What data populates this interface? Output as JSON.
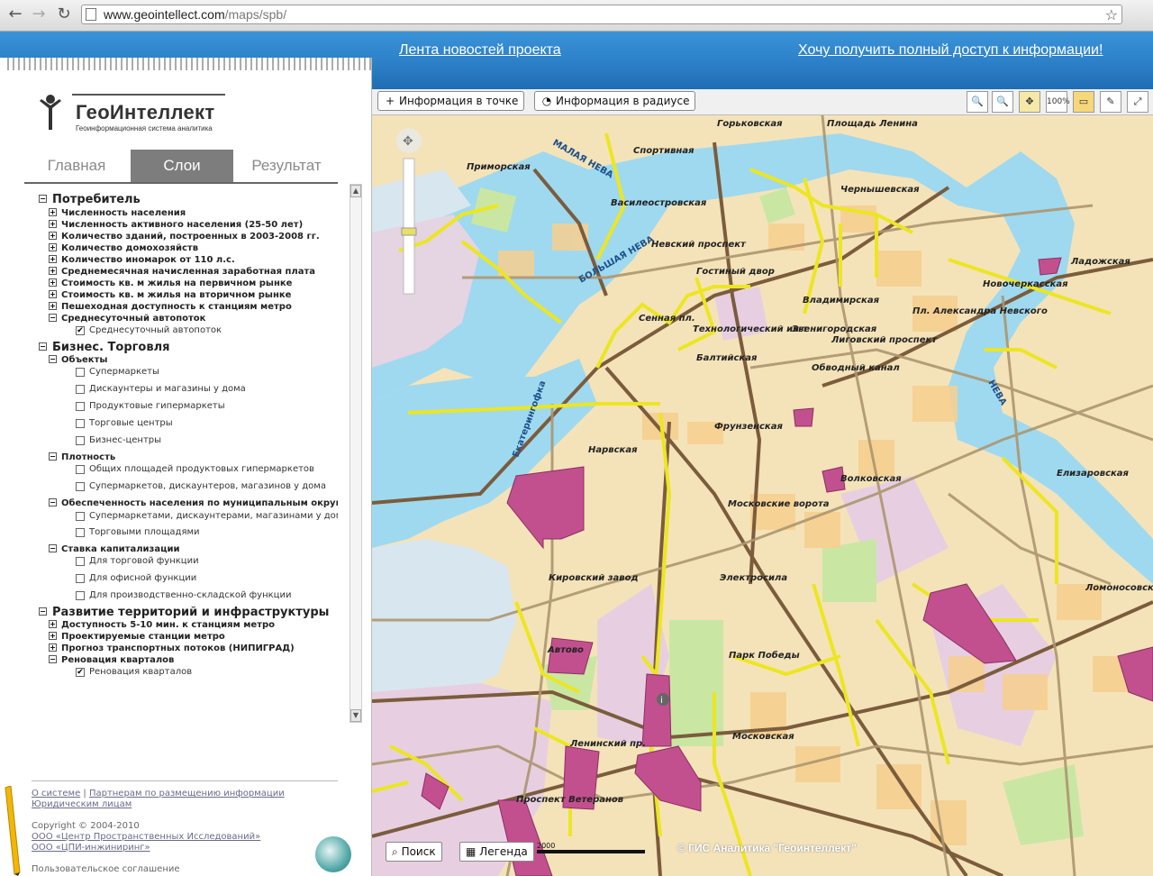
{
  "browser": {
    "url_host": "www.geointellect.com",
    "url_path": "/maps/spb/",
    "icons": [
      "back-icon",
      "forward-icon",
      "reload-icon",
      "page-icon",
      "star-icon"
    ]
  },
  "header": {
    "news_link": "Лента новостей проекта",
    "access_link": "Хочу получить полный доступ к информации!"
  },
  "logo": {
    "title": "ГеоИнтеллект",
    "subtitle": "Геоинформационная система аналитика"
  },
  "tabs": [
    {
      "label": "Главная",
      "active": false
    },
    {
      "label": "Слои",
      "active": true
    },
    {
      "label": "Результат",
      "active": false
    }
  ],
  "layers": {
    "group1": {
      "label": "Потребитель",
      "items": [
        "Численность населения",
        "Численность активного населения (25-50 лет)",
        "Количество зданий, построенных в 2003-2008 гг.",
        "Количество домохозяйств",
        "Количество иномарок от 110 л.с.",
        "Среднемесячная начисленная заработная плата",
        "Стоимость кв. м жилья на первичном рынке",
        "Стоимость кв. м жилья на вторичном рынке",
        "Пешеходная доступность к станциям метро",
        "Среднесуточный автопоток"
      ],
      "sub": {
        "label": "Среднесуточный автопоток",
        "checked": true
      }
    },
    "group2": {
      "label": "Бизнес. Торговля",
      "objects": {
        "label": "Объекты",
        "items": [
          "Супермаркеты",
          "Дискаунтеры и магазины у дома",
          "Продуктовые гипермаркеты",
          "Торговые центры",
          "Бизнес-центры"
        ]
      },
      "density": {
        "label": "Плотность",
        "items": [
          "Общих площадей продуктовых гипермаркетов",
          "Супермаркетов, дискаунтеров, магазинов у дома"
        ]
      },
      "provision": {
        "label": "Обеспеченность населения по муниципальным округам",
        "items": [
          "Супермаркетами, дискаунтерами, магазинами у дома",
          "Торговыми площадями"
        ]
      },
      "cap": {
        "label": "Ставка капитализации",
        "items": [
          "Для торговой функции",
          "Для офисной функции",
          "Для производственно-складской функции"
        ]
      }
    },
    "group3": {
      "label": "Развитие территорий и инфраструктуры",
      "items": [
        "Доступность 5-10 мин. к станциям метро",
        "Проектируемые станции метро",
        "Прогноз транспортных потоков (НИПИГРАД)",
        "Реновация кварталов"
      ],
      "sub": {
        "label": "Реновация кварталов",
        "checked": true
      }
    }
  },
  "footer": {
    "about": "О системе",
    "partners": "Партнерам по размещению информации",
    "legal": "Юридическим лицам",
    "copyright": "Copyright © 2004-2010",
    "org1": "ООО «Центр Пространственных Исследований»",
    "org2": "ООО «ЦПИ-инжиниринг»",
    "agreement": "Пользовательское соглашение"
  },
  "map_toolbar": {
    "info_point": "Информация в точке",
    "info_radius": "Информация в радиусе",
    "zoom_100": "100%"
  },
  "map": {
    "search_btn": "Поиск",
    "legend_btn": "Легенда",
    "scale_label": "2000",
    "copyright": "© ГИС Аналитика \"Геоинтеллект\"",
    "labels": {
      "l1": "Горьковская",
      "l2": "Площадь Ленина",
      "l3": "Спортивная",
      "l4": "Приморская",
      "l5": "Василеостровская",
      "l6": "Чернышевская",
      "l7": "Невский проспект",
      "l8": "Ладожская",
      "l9": "Новочеркасская",
      "l10": "Пл. Александра Невского",
      "l11": "Владимирская",
      "l12": "Звенигородская",
      "l13": "Лиговский проспект",
      "l14": "Обводный канал",
      "l15": "Фрунзенская",
      "l16": "Нарвская",
      "l17": "Елизаровская",
      "l18": "Московские ворота",
      "l19": "Электросила",
      "l20": "Кировский завод",
      "l21": "Ломоносовская",
      "l22": "Парк Победы",
      "l23": "Автово",
      "l24": "Московская",
      "l25": "Ленинский пр.",
      "l26": "Проспект Ветеранов",
      "l27": "Волковская",
      "r1": "МАЛАЯ НЕВА",
      "r2": "БОЛЬШАЯ НЕВА",
      "r3": "НЕВА",
      "r4": "Екатерингофка",
      "l28": "Сенная пл.",
      "l29": "Технологический ин-т",
      "l30": "Балтийская",
      "l31": "Гостиный двор"
    }
  },
  "colors": {
    "accent_blue": "#2b7ec6",
    "water": "#9fd9ef",
    "block": "#f7d9a8",
    "industrial": "#e8cfe0",
    "park": "#c9e7a3",
    "road_major": "#8a7450",
    "road_yellow": "#f0e92a",
    "renovation": "#c2508f"
  }
}
